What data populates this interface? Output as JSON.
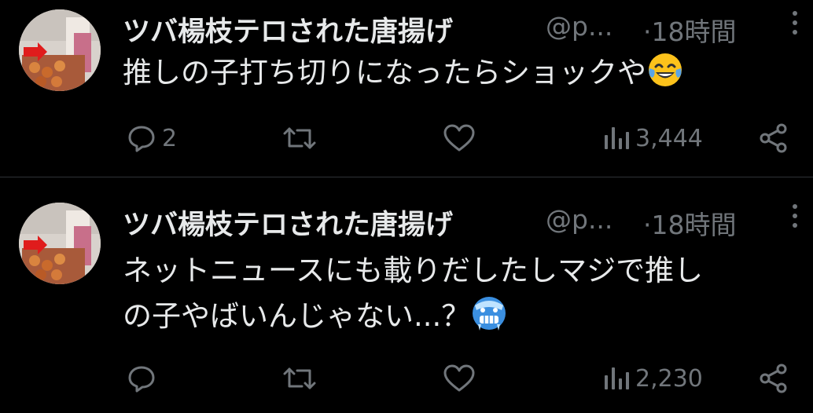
{
  "colors": {
    "background": "#000000",
    "text_primary": "#e7e9ea",
    "text_secondary": "#71767b",
    "divider": "#2f3336"
  },
  "tweets": [
    {
      "display_name": "ツバ楊枝テロされた唐揚げ",
      "handle": "@p...",
      "timestamp": "·18時間",
      "text": "推しの子打ち切りになったらショックや",
      "emoji": "face-with-tears-of-joy",
      "reply_count": "2",
      "retweet_count": "",
      "like_count": "",
      "views": "3,444",
      "icons": [
        "reply-icon",
        "retweet-icon",
        "like-icon",
        "views-icon",
        "share-icon",
        "more-icon"
      ]
    },
    {
      "display_name": "ツバ楊枝テロされた唐揚げ",
      "handle": "@p...",
      "timestamp": "·18時間",
      "text_line1": "ネットニュースにも載りだしたしマジで推し",
      "text_line2": "の子やばいんじゃない...？",
      "emoji": "cold-face",
      "reply_count": "",
      "retweet_count": "",
      "like_count": "",
      "views": "2,230",
      "icons": [
        "reply-icon",
        "retweet-icon",
        "like-icon",
        "views-icon",
        "share-icon",
        "more-icon"
      ]
    }
  ]
}
